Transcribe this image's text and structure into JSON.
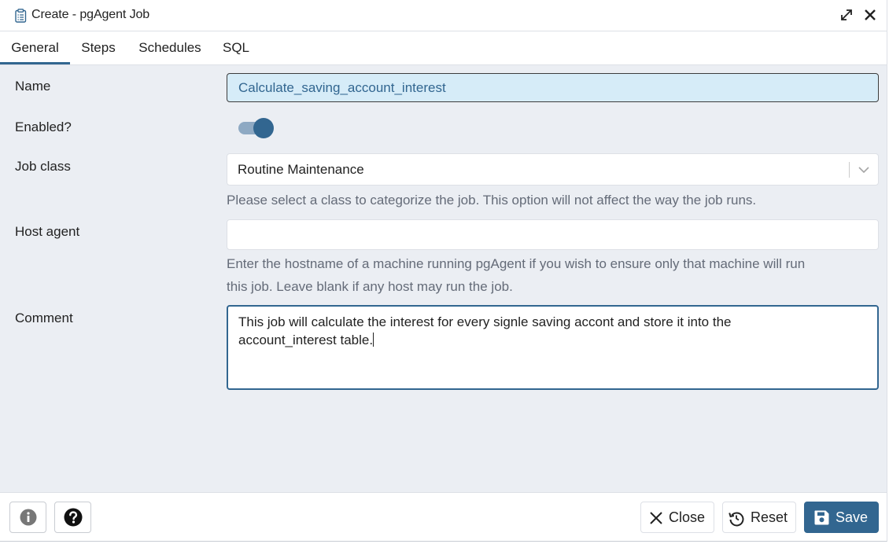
{
  "window": {
    "title": "Create - pgAgent Job",
    "title_icon": "clipboard-icon",
    "expand_icon": "expand-arrows-icon",
    "close_icon": "close-x-icon"
  },
  "tabs": [
    {
      "label": "General",
      "active": true
    },
    {
      "label": "Steps",
      "active": false
    },
    {
      "label": "Schedules",
      "active": false
    },
    {
      "label": "SQL",
      "active": false
    }
  ],
  "form": {
    "name": {
      "label": "Name",
      "value": "Calculate_saving_account_interest"
    },
    "enabled": {
      "label": "Enabled?",
      "value": true
    },
    "job_class": {
      "label": "Job class",
      "value": "Routine Maintenance",
      "help": "Please select a class to categorize the job. This option will not affect the way the job runs."
    },
    "host_agent": {
      "label": "Host agent",
      "value": "",
      "help_line1": "Enter the hostname of a machine running pgAgent if you wish to ensure only that machine will run",
      "help_line2": "this job. Leave blank if any host may run the job."
    },
    "comment": {
      "label": "Comment",
      "value": "This job will calculate the interest for every signle saving accont and store it into the\naccount_interest table."
    }
  },
  "footer": {
    "info_icon": "info-icon",
    "help_icon": "help-question-icon",
    "close_label": "Close",
    "reset_label": "Reset",
    "save_label": "Save"
  },
  "colors": {
    "accent": "#326690",
    "name_field_bg": "#d6ecf8",
    "toggle_track": "#8ea9c3",
    "help_text": "#646b78",
    "dialog_bg": "#ebeef3"
  }
}
